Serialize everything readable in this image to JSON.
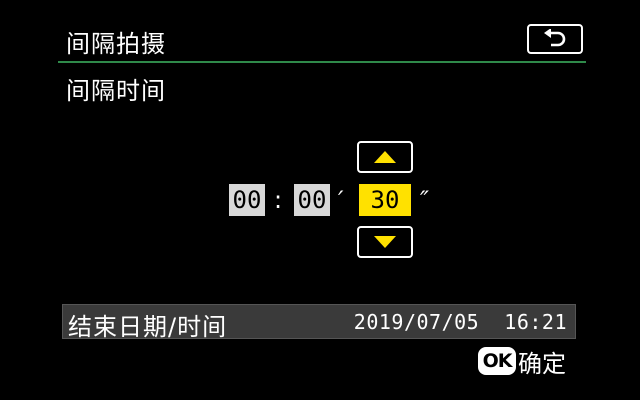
{
  "header": {
    "title": "间隔拍摄",
    "back_icon": "return-arrow-icon"
  },
  "section": {
    "subtitle": "间隔时间"
  },
  "interval": {
    "hours": "00",
    "minutes": "00",
    "seconds": "30",
    "colon": ":",
    "minute_mark": "′",
    "second_mark": "″",
    "selected_field": "seconds",
    "up_icon": "triangle-up-icon",
    "down_icon": "triangle-down-icon"
  },
  "end_time": {
    "label": "结束日期/时间",
    "value": "2019/07/05  16:21"
  },
  "footer": {
    "ok_icon_text": "OK",
    "ok_label": "确定"
  },
  "colors": {
    "selected": "#ffe100",
    "divider": "#2f8a4a"
  }
}
